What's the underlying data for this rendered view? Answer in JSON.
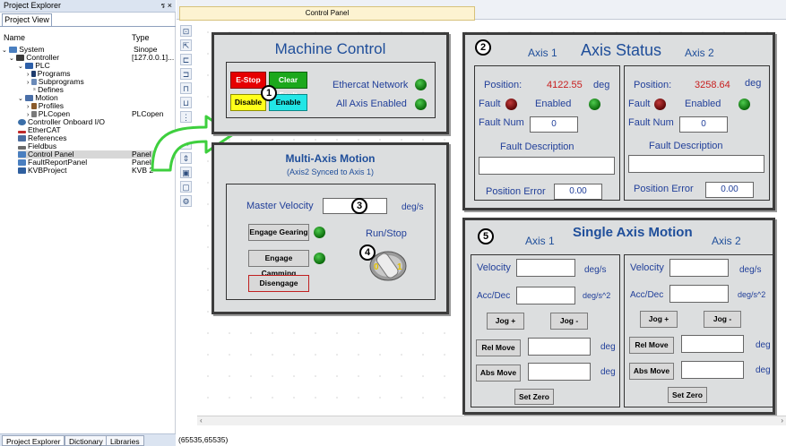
{
  "explorer": {
    "title": "Project Explorer",
    "controls": "ร ×",
    "tab": "Project View",
    "col_name": "Name",
    "col_type": "Type",
    "tree": [
      {
        "label": "System",
        "type": "Sinope"
      },
      {
        "label": "Controller",
        "type": "[127.0.0.1]..."
      },
      {
        "label": "PLC",
        "type": ""
      },
      {
        "label": "Programs",
        "type": ""
      },
      {
        "label": "Subprograms",
        "type": ""
      },
      {
        "label": "Defines",
        "type": ""
      },
      {
        "label": "Motion",
        "type": ""
      },
      {
        "label": "Profiles",
        "type": ""
      },
      {
        "label": "PLCopen",
        "type": "PLCopen"
      },
      {
        "label": "Controller Onboard I/O",
        "type": ""
      },
      {
        "label": "EtherCAT",
        "type": ""
      },
      {
        "label": "References",
        "type": ""
      },
      {
        "label": "Fieldbus",
        "type": ""
      },
      {
        "label": "Control Panel",
        "type": "Panel"
      },
      {
        "label": "FaultReportPanel",
        "type": "Panel"
      },
      {
        "label": "KVBProject",
        "type": "KVB 2"
      }
    ],
    "bottom_tabs": [
      "Project Explorer",
      "Dictionary",
      "Libraries"
    ]
  },
  "document": {
    "tab": "Control Panel",
    "status": "(65535,65535)"
  },
  "machine_control": {
    "title": "Machine Control",
    "estop": "E-Stop",
    "clear_fault": "Clear Fault",
    "disable": "Disable",
    "enable": "Enable",
    "ethercat_network": "Ethercat Network",
    "all_axis_enabled": "All Axis Enabled",
    "callout": "1"
  },
  "axis_status": {
    "title": "Axis Status",
    "callout": "2",
    "axis1": {
      "name": "Axis 1",
      "position_label": "Position:",
      "position": "4122.55",
      "unit": "deg",
      "fault": "Fault",
      "enabled": "Enabled",
      "fault_num_label": "Fault Num",
      "fault_num": "0",
      "fault_desc_label": "Fault Description",
      "pos_err_label": "Position Error",
      "pos_err": "0.00"
    },
    "axis2": {
      "name": "Axis 2",
      "position_label": "Position:",
      "position": "3258.64",
      "unit": "deg",
      "fault": "Fault",
      "enabled": "Enabled",
      "fault_num_label": "Fault Num",
      "fault_num": "0",
      "fault_desc_label": "Fault Description",
      "pos_err_label": "Position Error",
      "pos_err": "0.00"
    }
  },
  "multi_axis": {
    "title": "Multi-Axis Motion",
    "subtitle": "(Axis2 Synced to Axis 1)",
    "master_velocity": "Master Velocity",
    "velocity_unit": "deg/s",
    "engage_gearing": "Engage Gearing",
    "engage_camming": "Engage Camming",
    "disengage": "Disengage",
    "run_stop": "Run/Stop",
    "switch_off": "0",
    "switch_on": "1",
    "callout_velocity": "3",
    "callout_switch": "4"
  },
  "single_axis": {
    "title": "Single Axis Motion",
    "callout": "5",
    "axis1_name": "Axis 1",
    "axis2_name": "Axis 2",
    "velocity": "Velocity",
    "velocity_unit": "deg/s",
    "accdec": "Acc/Dec",
    "accdec_unit": "deg/s^2",
    "jog_plus": "Jog +",
    "jog_minus": "Jog -",
    "rel_move": "Rel Move",
    "abs_move": "Abs Move",
    "deg": "deg",
    "set_zero": "Set Zero"
  },
  "colors": {
    "accent_green": "#3ecf3e",
    "panel_bg": "#dcdedf",
    "title_blue": "#1f4e9a"
  }
}
